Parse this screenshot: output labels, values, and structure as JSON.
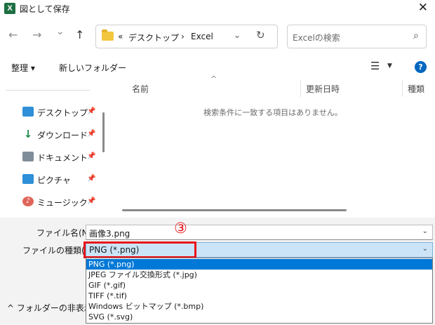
{
  "window": {
    "title": "図として保存",
    "app_icon": "X",
    "close": "✕"
  },
  "nav": {
    "back": "←",
    "forward": "→",
    "recent": "⌄",
    "up": "↑",
    "breadcrumb": [
      "«",
      "デスクトップ",
      "›",
      "Excel"
    ],
    "dropdown": "⌄",
    "refresh": "↻",
    "search_placeholder": "Excelの検索",
    "search_icon": "⌕"
  },
  "toolbar": {
    "organize": "整理 ▾",
    "new_folder": "新しいフォルダー",
    "view_icon": "☰",
    "view_drop": "▼",
    "help": "?"
  },
  "sidebar": {
    "items": [
      {
        "label": "デスクトップ",
        "icon": "desktop-icon"
      },
      {
        "label": "ダウンロード",
        "icon": "download-icon"
      },
      {
        "label": "ドキュメント",
        "icon": "document-icon"
      },
      {
        "label": "ピクチャ",
        "icon": "pictures-icon"
      },
      {
        "label": "ミュージック",
        "icon": "music-icon"
      }
    ],
    "pin": "📌"
  },
  "files": {
    "sort_caret": "^",
    "columns": [
      "名前",
      "更新日時",
      "種類"
    ],
    "empty_message": "検索条件に一致する項目はありません。"
  },
  "save": {
    "filename_label": "ファイル名(N):",
    "filename_value": "画像3.png",
    "filetype_label": "ファイルの種類(T):",
    "filetype_value": "PNG (*.png)",
    "caret": "⌄",
    "annotation": "③",
    "hide_folders": "^ フォルダーの非表示",
    "filetype_options": [
      "PNG (*.png)",
      "JPEG ファイル交換形式 (*.jpg)",
      "GIF (*.gif)",
      "TIFF (*.tif)",
      "Windows ビットマップ (*.bmp)",
      "SVG (*.svg)"
    ]
  },
  "colors": {
    "accent": "#0078d7",
    "annotation_red": "#e8141b",
    "selected_field": "#cce4f7"
  }
}
